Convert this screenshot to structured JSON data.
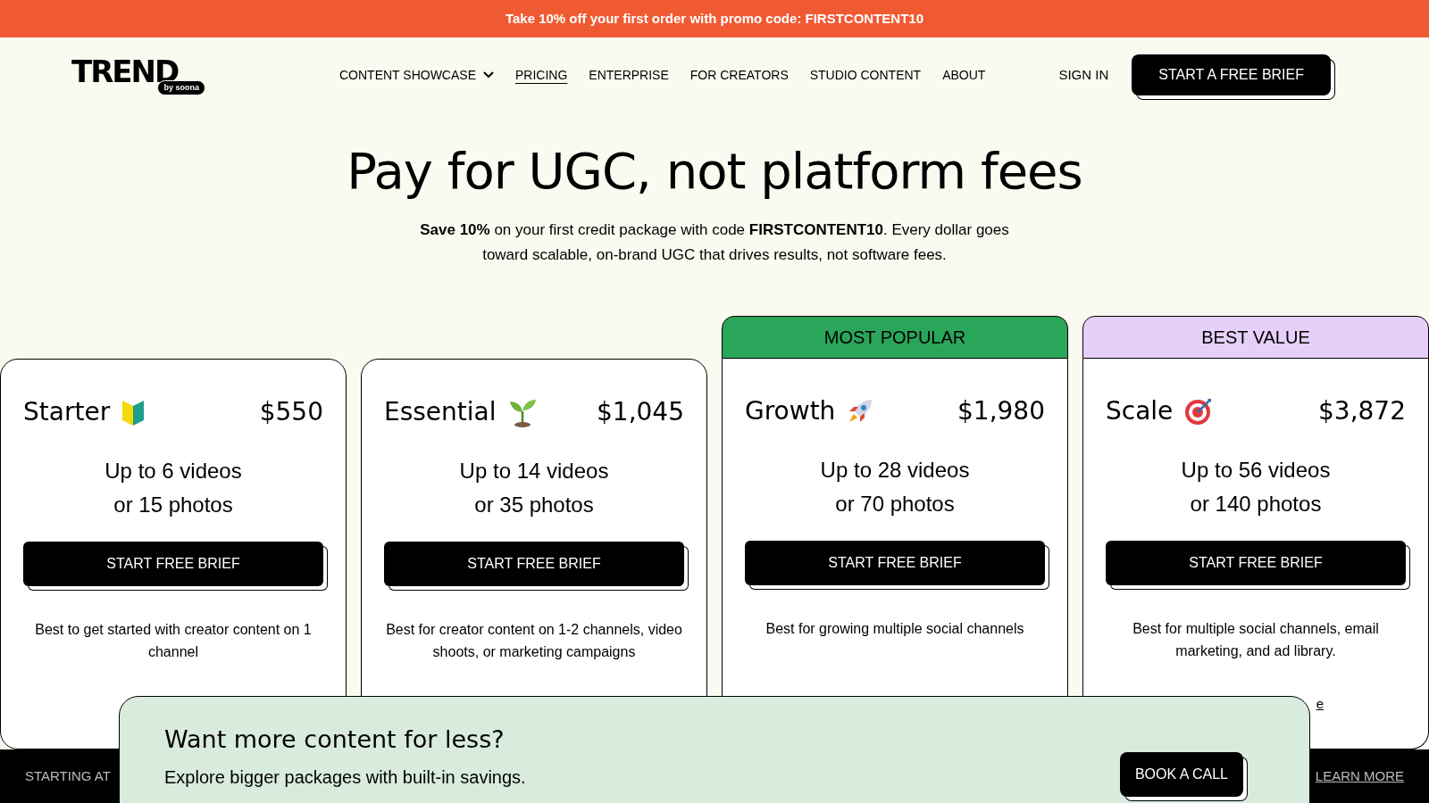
{
  "promo_bar": {
    "text": "Take 10% off your first order with promo code: FIRSTCONTENT10"
  },
  "nav": {
    "logo": {
      "word": "TREND",
      "sub": "by soona"
    },
    "links": [
      {
        "label": "CONTENT SHOWCASE",
        "selected": false,
        "dropdown": true
      },
      {
        "label": "PRICING",
        "selected": true,
        "dropdown": false
      },
      {
        "label": "ENTERPRISE",
        "selected": false,
        "dropdown": false
      },
      {
        "label": "FOR CREATORS",
        "selected": false,
        "dropdown": false
      },
      {
        "label": "STUDIO CONTENT",
        "selected": false,
        "dropdown": false
      },
      {
        "label": "ABOUT",
        "selected": false,
        "dropdown": false
      }
    ],
    "sign_in": "SIGN IN",
    "cta": "START A FREE BRIEF"
  },
  "hero": {
    "title": "Pay for UGC, not platform fees",
    "subtitle": "**Save 10%** on your first credit package with code **FIRSTCONTENT10**. Every dollar goes toward scalable, on-brand UGC that drives results, not software fees."
  },
  "plans": [
    {
      "name": "Starter",
      "price": "$550",
      "lines": [
        "Up to 6 videos",
        "or 15 photos"
      ],
      "button": "START FREE BRIEF",
      "description": "Best to get started with creator content on 1 channel"
    },
    {
      "name": "Essential",
      "price": "$1,045",
      "lines": [
        "Up to 14 videos",
        "or 35 photos"
      ],
      "button": "START FREE BRIEF",
      "description": "Best for creator content on 1-2 channels, video shoots, or marketing campaigns"
    },
    {
      "name": "Growth",
      "price": "$1,980",
      "lines": [
        "Up to 28 videos",
        "or 70 photos"
      ],
      "button": "START FREE BRIEF",
      "description": "Best for growing multiple social channels",
      "badge": {
        "text": "MOST POPULAR",
        "color": "#2aa65a"
      }
    },
    {
      "name": "Scale",
      "price": "$3,872",
      "lines": [
        "Up to 56 videos",
        "or 140 photos"
      ],
      "button": "START FREE BRIEF",
      "description": "Best for multiple social channels, email marketing, and ad library.",
      "badge": {
        "text": "BEST VALUE",
        "color": "#e6cff8"
      },
      "link": "e"
    }
  ],
  "footer_bar": {
    "left": "STARTING AT",
    "right": "LEARN MORE"
  },
  "banner": {
    "title": "Want more content for less?",
    "text": "Explore bigger packages with built-in savings.",
    "button": "BOOK A CALL"
  }
}
